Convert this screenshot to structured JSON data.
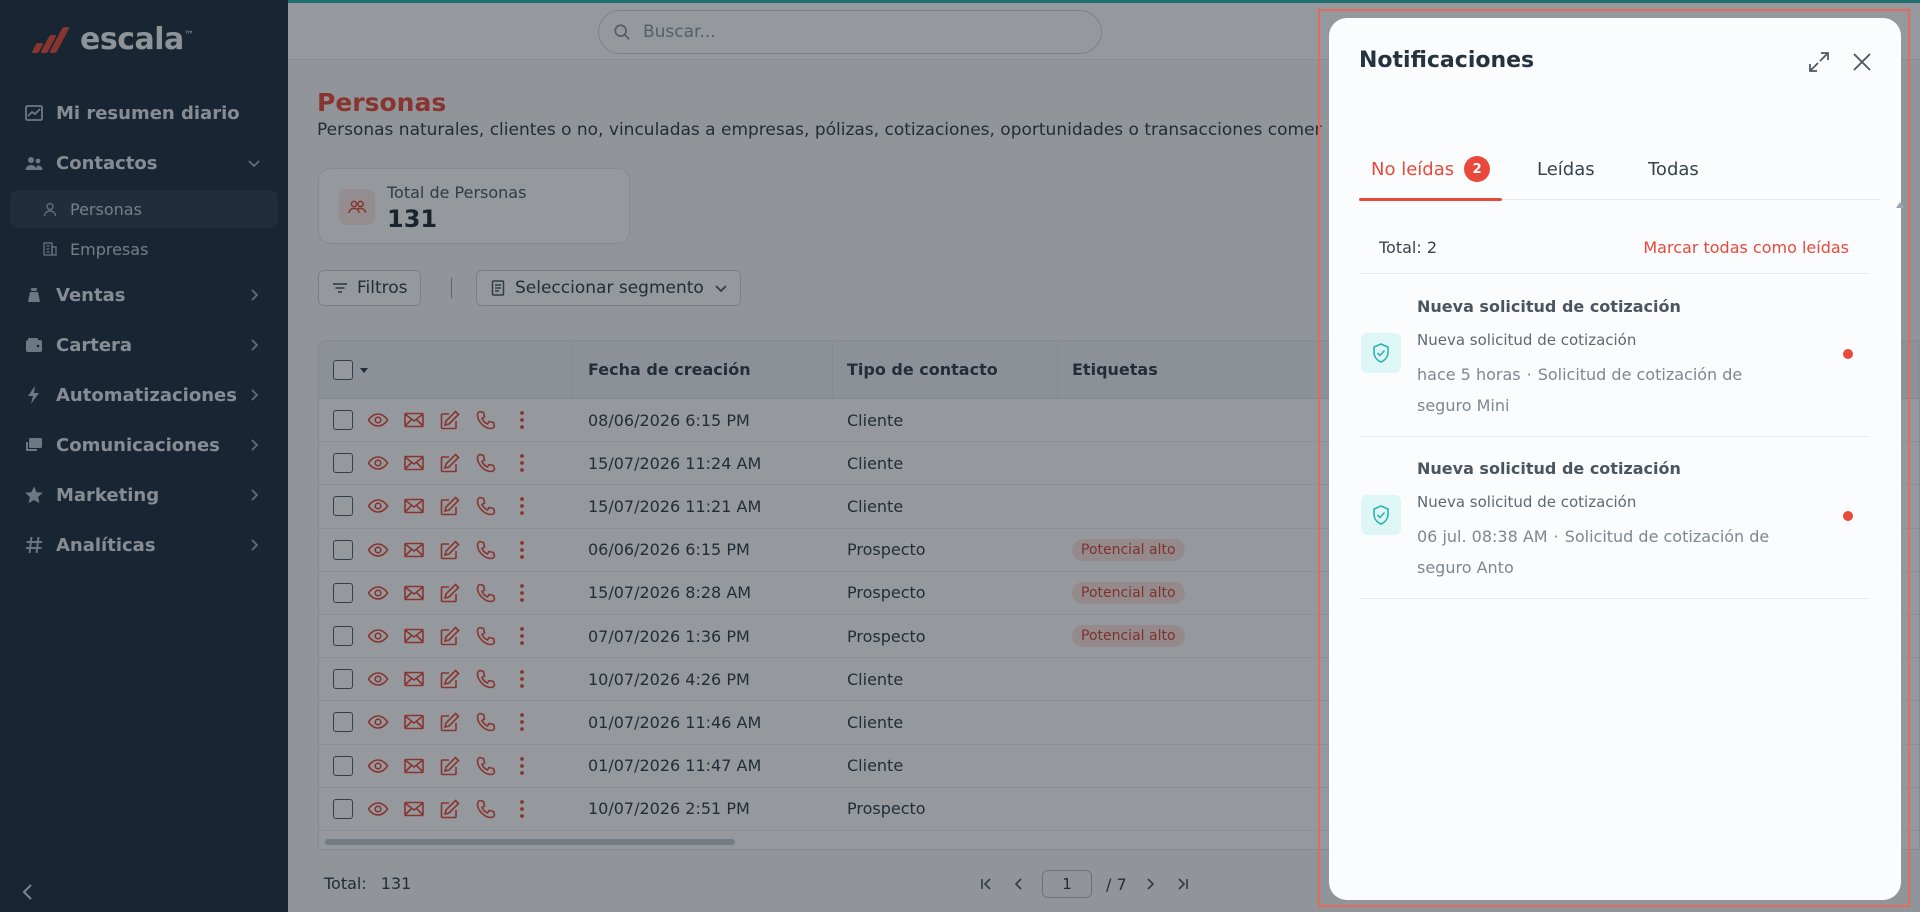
{
  "brand": {
    "name": "escala",
    "tm": "™"
  },
  "sidebar": {
    "items": [
      {
        "label": "Mi resumen diario",
        "icon": "chart-icon",
        "chevron": ""
      },
      {
        "label": "Contactos",
        "icon": "users-icon",
        "chevron": "down"
      },
      {
        "label": "Ventas",
        "icon": "sales-icon",
        "chevron": "right"
      },
      {
        "label": "Cartera",
        "icon": "wallet-icon",
        "chevron": "right"
      },
      {
        "label": "Automatizaciones",
        "icon": "bolt-icon",
        "chevron": "right"
      },
      {
        "label": "Comunicaciones",
        "icon": "chat-icon",
        "chevron": "right"
      },
      {
        "label": "Marketing",
        "icon": "star-icon",
        "chevron": "right"
      },
      {
        "label": "Analíticas",
        "icon": "hash-icon",
        "chevron": "right"
      }
    ],
    "subitems": [
      {
        "label": "Personas",
        "icon": "person-icon",
        "active": true
      },
      {
        "label": "Empresas",
        "icon": "building-icon",
        "active": false
      }
    ]
  },
  "search": {
    "placeholder": "Buscar..."
  },
  "page": {
    "title": "Personas",
    "description": "Personas naturales, clientes o no, vinculadas a empresas, pólizas, cotizaciones, oportunidades o transacciones comer"
  },
  "stat": {
    "label": "Total de Personas",
    "value": "131"
  },
  "toolbar": {
    "filters_label": "Filtros",
    "segment_label": "Seleccionar segmento"
  },
  "table": {
    "columns": [
      "Fecha de creación",
      "Tipo de contacto",
      "Etiquetas"
    ],
    "rows": [
      {
        "fecha": "08/06/2026 6:15 PM",
        "tipo": "Cliente",
        "etiqueta": ""
      },
      {
        "fecha": "15/07/2026 11:24 AM",
        "tipo": "Cliente",
        "etiqueta": ""
      },
      {
        "fecha": "15/07/2026 11:21 AM",
        "tipo": "Cliente",
        "etiqueta": ""
      },
      {
        "fecha": "06/06/2026 6:15 PM",
        "tipo": "Prospecto",
        "etiqueta": "Potencial alto"
      },
      {
        "fecha": "15/07/2026 8:28 AM",
        "tipo": "Prospecto",
        "etiqueta": "Potencial alto"
      },
      {
        "fecha": "07/07/2026 1:36 PM",
        "tipo": "Prospecto",
        "etiqueta": "Potencial alto"
      },
      {
        "fecha": "10/07/2026 4:26 PM",
        "tipo": "Cliente",
        "etiqueta": ""
      },
      {
        "fecha": "01/07/2026 11:46 AM",
        "tipo": "Cliente",
        "etiqueta": ""
      },
      {
        "fecha": "01/07/2026 11:47 AM",
        "tipo": "Cliente",
        "etiqueta": ""
      },
      {
        "fecha": "10/07/2026 2:51 PM",
        "tipo": "Prospecto",
        "etiqueta": ""
      }
    ]
  },
  "footer": {
    "total_label": "Total:",
    "total_value": "131",
    "page": "1",
    "page_total": "/ 7"
  },
  "notifications": {
    "title": "Notificaciones",
    "tabs": [
      {
        "label": "No leídas",
        "badge": "2",
        "active": true
      },
      {
        "label": "Leídas",
        "badge": "",
        "active": false
      },
      {
        "label": "Todas",
        "badge": "",
        "active": false
      }
    ],
    "total": "Total: 2",
    "mark_all": "Marcar todas como leídas",
    "items": [
      {
        "title": "Nueva solicitud de cotización",
        "subtitle": "Nueva solicitud de cotización",
        "time": "hace 5 horas",
        "detail": "Solicitud de cotización de seguro Mini",
        "unread": true
      },
      {
        "title": "Nueva solicitud de cotización",
        "subtitle": "Nueva solicitud de cotización",
        "time": "06 jul. 08:38 AM",
        "detail": "Solicitud de cotización de seguro Anto",
        "unread": true
      }
    ]
  },
  "colors": {
    "accent": "#e8493a",
    "sidebar": "#1d2d3c",
    "teal": "#2bb3b0"
  }
}
